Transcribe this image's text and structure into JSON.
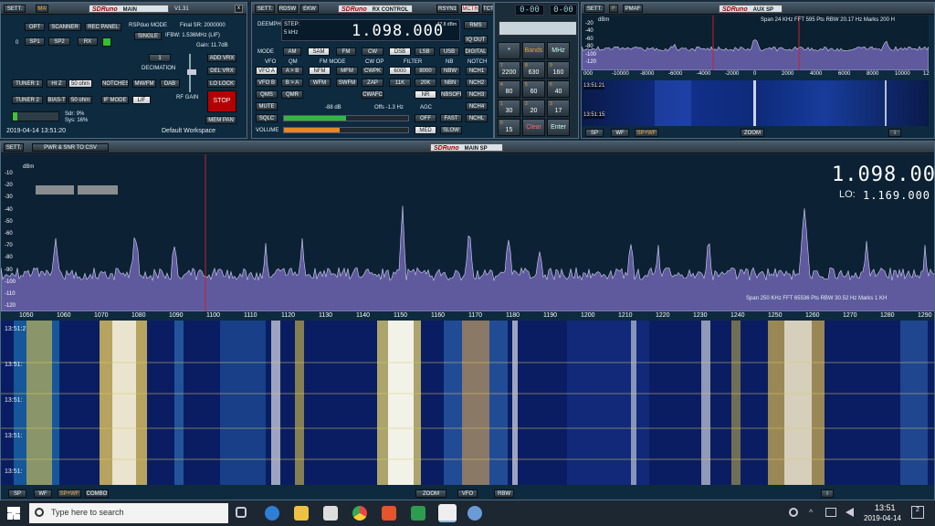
{
  "main": {
    "sett": "SETT.",
    "ma": "MA",
    "title": "MAIN",
    "version": "V1.31",
    "opt": "OPT",
    "scanner": "SCANNER",
    "rec_panel": "REC PANEL",
    "rspduo": "RSPduo MODE",
    "single": "SINGLE",
    "final_sr": "Final SR:  2000000",
    "ifbw": "IFBW: 1.536MHz (LIF)",
    "gain": "Gain: 11.7dB",
    "zero": "0",
    "sp1": "SP1",
    "sp2": "SP2",
    "rx": "RX",
    "one": "1",
    "decimation": "DECIMATION",
    "tuner1": "TUNER 1",
    "hiz": "HI Z",
    "ohm50a": "50 ohm",
    "notches": "NOTCHES",
    "mwfm": "MW/FM",
    "dab": "DAB",
    "tuner2": "TUNER 2",
    "biast": "BIAS-T",
    "ohm50b": "50 ohm",
    "ifmode": "IF MODE",
    "lif": "LIF",
    "rfgain": "RF GAIN",
    "add_vrx": "ADD VRX",
    "del_vrx": "DEL VRX",
    "lo_lock": "LO LOCK",
    "stop": "STOP",
    "mem_pan": "MEM PAN",
    "sdr": "Sdr: 9%",
    "sys": "Sys: 16%",
    "datetime": "2019-04-14 13:51:20",
    "workspace": "Default Workspace",
    "sdr_load": 0.09,
    "sys_load": 0.16
  },
  "rx": {
    "sett": "SETT.",
    "rdsw": "RDSW",
    "ekw": "EKW",
    "title": "RX CONTROL",
    "rsyn": "RSYN1",
    "mctr": "MCTR",
    "tctr": "TCTR",
    "deemph": "DEEMPH",
    "step_label": "STEP:",
    "step": "5 kHz",
    "freq": "1.098.000",
    "level": "-47.8 dBm",
    "rms": "RMS",
    "iqout": "IQ OUT",
    "digital": "DIGITAL",
    "mode": "MODE",
    "am": "AM",
    "sam": "SAM",
    "fm": "FM",
    "cw": "CW",
    "dsb": "DSB",
    "lsb": "LSB",
    "usb": "USB",
    "vfo": "VFO",
    "qm": "QM",
    "fm_mode": "FM MODE",
    "cw_op": "CW OP",
    "filter": "FILTER",
    "nb": "NB",
    "notch": "NOTCH",
    "vfoa": "VFO A",
    "ab": "A > B",
    "nfm": "NFM",
    "mfm": "MFM",
    "cwpk": "CWPK",
    "f6000": "6000",
    "f8000": "8000",
    "nbw": "NBW",
    "nch1": "NCH1",
    "vfob": "VFO B",
    "ba": "B > A",
    "wfm": "WFM",
    "swfm": "SWFM",
    "zap": "ZAP",
    "f11k": "11K",
    "f20k": "20K",
    "nbn": "NBN",
    "nch2": "NCH2",
    "qms": "QMS",
    "qmr": "QMR",
    "cwafc": "CWAFC",
    "nr": "NR",
    "nbsoff": "NBSOFF",
    "nch3": "NCH3",
    "mute": "MUTE",
    "nch4": "NCH4",
    "sqlc": "SQLC",
    "sq_level": "-88 dB",
    "offs": "Offs -1.3 Hz",
    "agc": "AGC",
    "off": "OFF",
    "fast": "FAST",
    "nchl": "NCHL",
    "volume": "VOLUME",
    "med": "MED",
    "slow": "SLOW",
    "sq": 0.5,
    "vol": 0.45
  },
  "keypad": {
    "digits": [
      "0-00",
      "0-00"
    ],
    "star": "*",
    "bands": "Bands",
    "mhz": "MHz",
    "keys": [
      {
        "n": "7",
        "v": "2200"
      },
      {
        "n": "8",
        "v": "630"
      },
      {
        "n": "9",
        "v": "160"
      },
      {
        "n": "4",
        "v": "80"
      },
      {
        "n": "5",
        "v": "60"
      },
      {
        "n": "6",
        "v": "40"
      },
      {
        "n": "1",
        "v": "30"
      },
      {
        "n": "2",
        "v": "20"
      },
      {
        "n": "3",
        "v": "17"
      },
      {
        "n": "0",
        "v": "15"
      }
    ],
    "clear": "Clear",
    "enter": "Enter"
  },
  "aux": {
    "sett": "SETT.",
    "f": "F",
    "pmaf": "PMAF",
    "title": "AUX SP",
    "dbm": "dBm",
    "info": "Span 24 KHz   FFT 595 Pts   RBW 20.17 Hz   Marks 200 H",
    "yticks": [
      "-20",
      "-40",
      "-60",
      "-80",
      "-100",
      "-120"
    ],
    "xticks": [
      "000",
      "-10000",
      "-8000",
      "-6000",
      "-4000",
      "-2000",
      "0",
      "2000",
      "4000",
      "6000",
      "8000",
      "10000",
      "12"
    ],
    "times": [
      "13:51:21",
      "13:51:15"
    ],
    "sp": "SP",
    "wf": "WF",
    "spwf": "SP+WF",
    "zoom": "ZOOM",
    "i": "i"
  },
  "sp": {
    "title": "MAIN SP",
    "pwr": "PWR & SNR TO CSV",
    "dbm": "dBm",
    "freq": "1.098.000",
    "lo_label": "LO:",
    "lo": "1.169.000",
    "yticks": [
      "-10",
      "-20",
      "-30",
      "-40",
      "-50",
      "-60",
      "-70",
      "-80",
      "-90",
      "-100",
      "-110",
      "-120"
    ],
    "xticks": [
      "1050",
      "1060",
      "1070",
      "1080",
      "1090",
      "1100",
      "1110",
      "1120",
      "1130",
      "1140",
      "1150",
      "1160",
      "1170",
      "1180",
      "1190",
      "1200",
      "1210",
      "1220",
      "1230",
      "1240",
      "1250",
      "1260",
      "1270",
      "1280",
      "1290"
    ],
    "info": "Span 250 KHz   FFT 65536 Pts   RBW 30.52 Hz   Marks 1 KH",
    "times": [
      "13:51:2",
      "13:51:",
      "13:51:",
      "13:51:",
      "13:51:"
    ],
    "sp": "SP",
    "wf": "WF",
    "spwf": "SP+WF",
    "combo": "COMBO",
    "zoom": "ZOOM",
    "vfo": "VFO",
    "rbw": "RBW",
    "i": "i"
  },
  "taskbar": {
    "search": "Type here to search",
    "time": "13:51",
    "date": "2019-04-14",
    "notif": "2"
  },
  "colors": {
    "panel": "#0d2a3f",
    "accent": "#3aa0d8",
    "stop": "#b50000",
    "spectrum_fill": "#5f5a9e"
  }
}
